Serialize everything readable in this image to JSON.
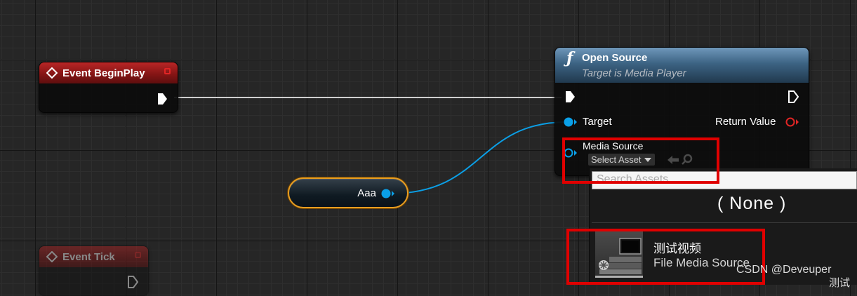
{
  "nodes": {
    "event_begin_play": {
      "title": "Event BeginPlay"
    },
    "event_tick": {
      "title": "Event Tick"
    },
    "open_source": {
      "title": "Open Source",
      "subtitle": "Target is Media Player",
      "target_label": "Target",
      "return_value_label": "Return Value",
      "media_source_label": "Media Source",
      "select_asset_label": "Select Asset"
    },
    "variable": {
      "name": "Aaa"
    }
  },
  "asset_picker": {
    "search_placeholder": "Search Assets",
    "none_label": "( None )",
    "items": [
      {
        "name": "测试视频",
        "type": "File Media Source"
      }
    ],
    "partial_text": "测试"
  },
  "watermark": "CSDN @Deveuper",
  "colors": {
    "event_header": "#b92626",
    "function_header": "#3c6383",
    "object_pin": "#0aa0e8",
    "return_pin": "#e02525",
    "variable_border": "#e79d22",
    "highlight": "#e00000"
  }
}
